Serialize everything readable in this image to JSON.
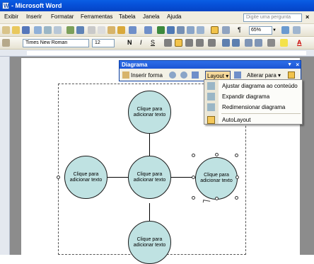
{
  "window": {
    "title": "- Microsoft Word"
  },
  "menu": {
    "items": [
      "Exibir",
      "Inserir",
      "Formatar",
      "Ferramentas",
      "Tabela",
      "Janela",
      "Ajuda"
    ],
    "help_placeholder": "Digite uma pergunta",
    "close": "×"
  },
  "toolbar": {
    "zoom": "65%",
    "font_name": "Times New Roman",
    "font_size": "12",
    "bold": "N",
    "italic": "I",
    "underline": "S",
    "font_color_label": "A"
  },
  "diagram_toolbar": {
    "title": "Diagrama",
    "insert_shape": "Inserir forma",
    "layout": "Layout",
    "change_to": "Alterar para"
  },
  "layout_menu": {
    "items": [
      "Ajustar diagrama ao conteúdo",
      "Expandir diagrama",
      "Redimensionar diagrama",
      "AutoLayout"
    ]
  },
  "diagram": {
    "nodes": [
      "Clique para adicionar texto",
      "Clique para adicionar texto",
      "Clique para adicionar texto",
      "Clique para adicionar texto",
      "Clique para adicionar texto"
    ]
  },
  "colors": {
    "circle_fill": "#bfe2e2",
    "title_bar": "#0a5ee4",
    "menu_bg": "#f0ede0"
  }
}
